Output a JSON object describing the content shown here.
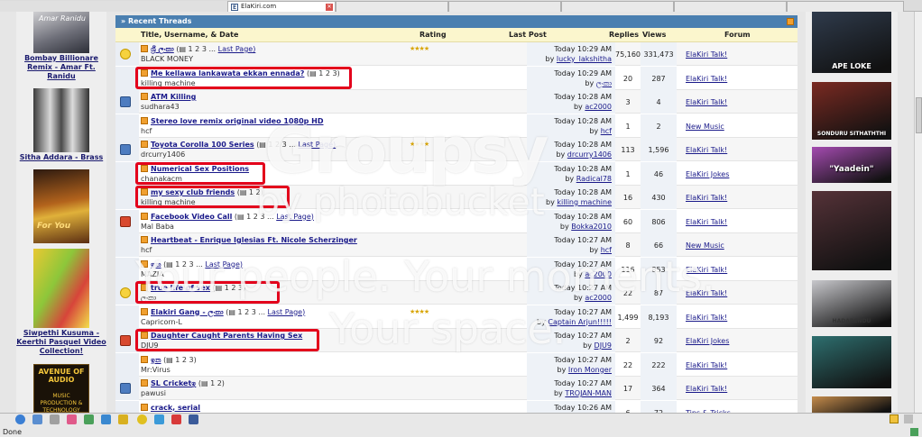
{
  "browser": {
    "tabs": [
      {
        "title": "ElaKiri.com",
        "active": true
      }
    ],
    "status_text": "Done"
  },
  "left_sidebar": [
    {
      "caption": "Bombay Billionare Remix - Amar Ft. Ranidu",
      "thumb_text": "Amar Ranidu",
      "icon": "album-cover"
    },
    {
      "caption": "Sitha Addara - Brass",
      "icon": "band-photo"
    },
    {
      "caption": "",
      "thumb_text": "For You",
      "icon": "album-cover"
    },
    {
      "caption": "Siwpethi Kusuma - Keerthi Pasquel Video Collection!",
      "icon": "album-cover"
    },
    {
      "caption": "",
      "thumb_text": "AVENUE OF AUDIO",
      "thumb_sub": "MUSIC PRODUCTION & TECHNOLOGY PROGRAME",
      "icon": "ad-banner"
    }
  ],
  "right_sidebar": [
    {
      "label": "APE LOKE",
      "color": "#2f3b4c"
    },
    {
      "label": "SONDURU SITHATHTHI",
      "color": "#7a2a22"
    },
    {
      "label": "\"Yaadein\"",
      "color": "#a44bb0"
    },
    {
      "label": "",
      "color": "#553238"
    },
    {
      "label": "HADARENDU",
      "color": "#c8c8cc"
    },
    {
      "label": "",
      "color": "#2e6f6f"
    },
    {
      "label": "",
      "color": "#c58c4b"
    }
  ],
  "forum": {
    "header_title": "» Recent Threads",
    "columns": {
      "title": "Title, Username, & Date",
      "rating": "Rating",
      "last_post": "Last Post",
      "replies": "Replies",
      "views": "Views",
      "forum": "Forum"
    },
    "rows": [
      {
        "icon": "smiley-icon",
        "title": "ශ්‍රී ලංකා",
        "pages": "(▤ 1 2 3 ...",
        "last_page": "Last Page)",
        "user": "BLACK MONEY",
        "rating": "★★★★",
        "post_time": "Today 10:29 AM",
        "post_by": "lucky_lakshitha",
        "replies": "75,160",
        "views": "331,473",
        "forum": "ElaKiri Talk!",
        "highlight": false
      },
      {
        "icon": "none",
        "title": "Me kellawa lankawata ekkan ennada?",
        "pages": "(▤ 1 2 3)",
        "last_page": "",
        "user": "killing machine",
        "rating": "",
        "post_time": "Today 10:29 AM",
        "post_by": "ලංකා",
        "replies": "20",
        "views": "287",
        "forum": "ElaKiri Talk!",
        "highlight": true
      },
      {
        "icon": "square-icon",
        "title": "ATM Killing",
        "pages": "",
        "last_page": "",
        "user": "sudhara43",
        "rating": "",
        "post_time": "Today 10:28 AM",
        "post_by": "ac2000",
        "replies": "3",
        "views": "4",
        "forum": "ElaKiri Talk!",
        "highlight": false
      },
      {
        "icon": "none",
        "title": "Stereo love remix original video 1080p HD",
        "pages": "",
        "last_page": "",
        "user": "hcf",
        "rating": "",
        "post_time": "Today 10:28 AM",
        "post_by": "hcf",
        "replies": "1",
        "views": "2",
        "forum": "New Music",
        "highlight": false
      },
      {
        "icon": "square-icon",
        "title": "Toyota Corolla 100 Series",
        "pages": "(▤ 1 2 3 ...",
        "last_page": "Last Page)",
        "user": "drcurry1406",
        "rating": "★★★★",
        "post_time": "Today 10:28 AM",
        "post_by": "drcurry1406",
        "replies": "113",
        "views": "1,596",
        "forum": "ElaKiri Talk!",
        "highlight": false
      },
      {
        "icon": "none",
        "title": "Numerical Sex Positions",
        "pages": "",
        "last_page": "",
        "user": "chanakacm",
        "rating": "",
        "post_time": "Today 10:28 AM",
        "post_by": "Radical78",
        "replies": "1",
        "views": "46",
        "forum": "ElaKiri Jokes",
        "highlight": true
      },
      {
        "icon": "none",
        "title": "my sexy club friends",
        "pages": "(▤ 1 2)",
        "last_page": "",
        "user": "killing machine",
        "rating": "",
        "post_time": "Today 10:28 AM",
        "post_by": "killing machine",
        "replies": "16",
        "views": "430",
        "forum": "ElaKiri Talk!",
        "highlight": true
      },
      {
        "icon": "red-square-icon",
        "title": "Facebook Video Call",
        "pages": "(▤ 1 2 3 ...",
        "last_page": "Last Page)",
        "user": "Mal Baba",
        "rating": "",
        "post_time": "Today 10:28 AM",
        "post_by": "Bokka2010",
        "replies": "60",
        "views": "806",
        "forum": "ElaKiri Talk!",
        "highlight": false
      },
      {
        "icon": "none",
        "title": "Heartbeat - Enrique Iglesias Ft. Nicole Scherzinger",
        "pages": "",
        "last_page": "",
        "user": "hcf",
        "rating": "",
        "post_time": "Today 10:27 AM",
        "post_by": "hcf",
        "replies": "8",
        "views": "66",
        "forum": "New Music",
        "highlight": false
      },
      {
        "icon": "none",
        "title": "ඉන",
        "pages": "(▤ 1 2 3 ...",
        "last_page": "Last Page)",
        "user": "MAZIA",
        "rating": "",
        "post_time": "Today 10:27 AM",
        "post_by": "ac2000",
        "replies": "116",
        "views": "853",
        "forum": "ElaKiri Talk!",
        "highlight": false
      },
      {
        "icon": "smiley-icon",
        "title": "true life of sex",
        "pages": "(▤ 1 2 3)",
        "last_page": "",
        "user": "ලංකා",
        "rating": "",
        "post_time": "Today 10:27 AM",
        "post_by": "ac2000",
        "replies": "22",
        "views": "87",
        "forum": "ElaKiri Talk!",
        "highlight": true
      },
      {
        "icon": "none",
        "title": "Elakiri Gang - ලංකා",
        "pages": "(▤ 1 2 3 ...",
        "last_page": "Last Page)",
        "user": "Capricorn-L",
        "rating": "★★★★",
        "post_time": "Today 10:27 AM",
        "post_by": "Captain Arjun!!!!!",
        "replies": "1,499",
        "views": "8,193",
        "forum": "ElaKiri Talk!",
        "highlight": false
      },
      {
        "icon": "red-square-icon",
        "title": "Daughter Caught Parents Having Sex",
        "pages": "",
        "last_page": "",
        "user": "DJU9",
        "rating": "",
        "post_time": "Today 10:27 AM",
        "post_by": "DJU9",
        "replies": "2",
        "views": "92",
        "forum": "ElaKiri Jokes",
        "highlight": true
      },
      {
        "icon": "none",
        "title": "ඉන",
        "pages": "(▤ 1 2 3)",
        "last_page": "",
        "user": "Mr:Virus",
        "rating": "",
        "post_time": "Today 10:27 AM",
        "post_by": "Iron Monger",
        "replies": "22",
        "views": "222",
        "forum": "ElaKiri Talk!",
        "highlight": false
      },
      {
        "icon": "chart-icon",
        "title": "SL Cricketඉ",
        "pages": "(▤ 1 2)",
        "last_page": "",
        "user": "pawusi",
        "rating": "",
        "post_time": "Today 10:27 AM",
        "post_by": "TROJAN-MAN",
        "replies": "17",
        "views": "364",
        "forum": "ElaKiri Talk!",
        "highlight": false
      },
      {
        "icon": "none",
        "title": "crack, serial",
        "pages": "",
        "last_page": "",
        "user": "",
        "rating": "",
        "post_time": "Today 10:26 AM",
        "post_by": "",
        "replies": "6",
        "views": "72",
        "forum": "Tips & Tricks",
        "highlight": false
      }
    ]
  },
  "watermark": {
    "brand": "Groupsy",
    "sub": "by photobucket",
    "tag1": "Your people. Your moments.",
    "tag2": "Your space."
  },
  "colors": {
    "header_blue": "#4a7fb0",
    "column_header": "#fbf6cd",
    "link": "#1a1a8a",
    "highlight_red": "#e3001b"
  }
}
